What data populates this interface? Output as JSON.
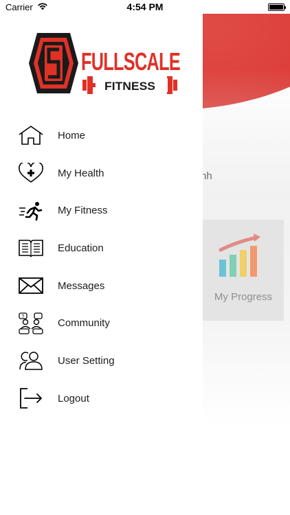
{
  "status_bar": {
    "carrier": "Carrier",
    "time": "4:54 PM"
  },
  "brand": {
    "name_top": "FULLSCALE",
    "name_bottom": "FITNESS",
    "accent_color": "#d8302c"
  },
  "background_screen": {
    "partial_text": "hh",
    "progress_tile_label": "My Progress"
  },
  "menu": [
    {
      "label": "Home",
      "icon": "home-icon"
    },
    {
      "label": "My Health",
      "icon": "heart-plus-icon"
    },
    {
      "label": "My Fitness",
      "icon": "running-icon"
    },
    {
      "label": "Education",
      "icon": "book-icon"
    },
    {
      "label": "Messages",
      "icon": "envelope-icon"
    },
    {
      "label": "Community",
      "icon": "community-icon"
    },
    {
      "label": "User Setting",
      "icon": "users-icon"
    },
    {
      "label": "Logout",
      "icon": "logout-icon"
    }
  ]
}
